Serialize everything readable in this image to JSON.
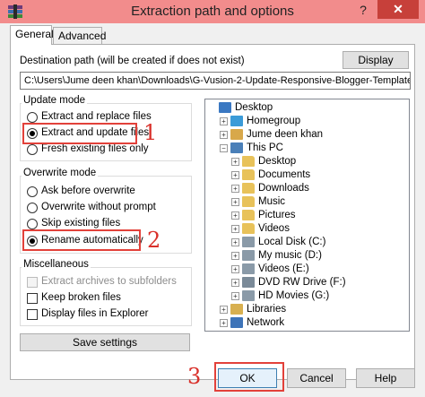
{
  "window": {
    "title": "Extraction path and options",
    "help_symbol": "?",
    "close_symbol": "✕"
  },
  "tabs": [
    {
      "label": "General",
      "active": true
    },
    {
      "label": "Advanced",
      "active": false
    }
  ],
  "destination": {
    "label": "Destination path (will be created if does not exist)",
    "value": "C:\\Users\\Jume deen khan\\Downloads\\G-Vusion-2-Update-Responsive-Blogger-Template",
    "display_button": "Display"
  },
  "update_mode": {
    "title": "Update mode",
    "options": [
      {
        "label": "Extract and replace files",
        "selected": false
      },
      {
        "label": "Extract and update files",
        "selected": true
      },
      {
        "label": "Fresh existing files only",
        "selected": false
      }
    ]
  },
  "overwrite_mode": {
    "title": "Overwrite mode",
    "options": [
      {
        "label": "Ask before overwrite",
        "selected": false
      },
      {
        "label": "Overwrite without prompt",
        "selected": false
      },
      {
        "label": "Skip existing files",
        "selected": false
      },
      {
        "label": "Rename automatically",
        "selected": true
      }
    ]
  },
  "misc": {
    "title": "Miscellaneous",
    "options": [
      {
        "label": "Extract archives to subfolders",
        "checked": false,
        "disabled": true
      },
      {
        "label": "Keep broken files",
        "checked": false,
        "disabled": false
      },
      {
        "label": "Display files in Explorer",
        "checked": false,
        "disabled": false
      }
    ]
  },
  "save_settings": "Save settings",
  "tree": {
    "items": [
      {
        "label": "Desktop",
        "icon": "desktop-icon",
        "expander": ""
      },
      {
        "label": "Homegroup",
        "icon": "homegroup-icon",
        "expander": "+"
      },
      {
        "label": "Jume deen khan",
        "icon": "user-icon",
        "expander": "+"
      },
      {
        "label": "This PC",
        "icon": "computer-icon",
        "expander": "−"
      },
      {
        "label": "Desktop",
        "icon": "folder-icon",
        "expander": "+"
      },
      {
        "label": "Documents",
        "icon": "folder-icon",
        "expander": "+"
      },
      {
        "label": "Downloads",
        "icon": "folder-icon",
        "expander": "+"
      },
      {
        "label": "Music",
        "icon": "folder-icon",
        "expander": "+"
      },
      {
        "label": "Pictures",
        "icon": "folder-icon",
        "expander": "+"
      },
      {
        "label": "Videos",
        "icon": "folder-icon",
        "expander": "+"
      },
      {
        "label": "Local Disk (C:)",
        "icon": "drive-icon",
        "expander": "+"
      },
      {
        "label": "My music (D:)",
        "icon": "drive-icon",
        "expander": "+"
      },
      {
        "label": "Videos (E:)",
        "icon": "drive-icon",
        "expander": "+"
      },
      {
        "label": "DVD RW Drive (F:)",
        "icon": "dvd-drive-icon",
        "expander": "+"
      },
      {
        "label": "HD Movies (G:)",
        "icon": "drive-icon",
        "expander": "+"
      },
      {
        "label": "Libraries",
        "icon": "libraries-icon",
        "expander": "+"
      },
      {
        "label": "Network",
        "icon": "network-icon",
        "expander": "+"
      }
    ]
  },
  "buttons": {
    "ok": "OK",
    "cancel": "Cancel",
    "help": "Help"
  },
  "annotations": {
    "one": "1",
    "two": "2",
    "three": "3"
  },
  "colors": {
    "titlebar": "#f28c8c",
    "close_button": "#c7403a",
    "annotation_red": "#e2413a"
  }
}
